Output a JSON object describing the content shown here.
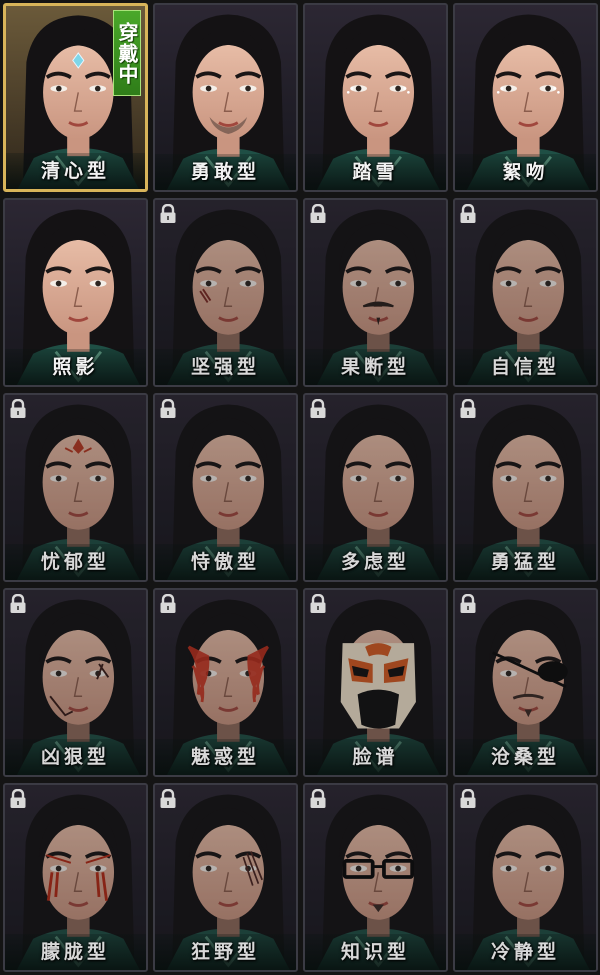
{
  "wearing_badge": "穿戴中",
  "colors": {
    "selected_border": "#d8b45a",
    "badge_green": "#3d9a24",
    "robe": "#1f4f45"
  },
  "faces": [
    {
      "label": "清心型",
      "locked": false,
      "selected": true,
      "markings": "forehead-jewel"
    },
    {
      "label": "勇敢型",
      "locked": false,
      "selected": false,
      "markings": "stubble"
    },
    {
      "label": "踏雪",
      "locked": false,
      "selected": false,
      "markings": "white-eye-dots"
    },
    {
      "label": "絮吻",
      "locked": false,
      "selected": false,
      "markings": "white-eye-dots"
    },
    {
      "label": "照影",
      "locked": false,
      "selected": false,
      "markings": "none"
    },
    {
      "label": "坚强型",
      "locked": true,
      "selected": false,
      "markings": "cheek-scar"
    },
    {
      "label": "果断型",
      "locked": true,
      "selected": false,
      "markings": "mustache"
    },
    {
      "label": "自信型",
      "locked": true,
      "selected": false,
      "markings": "none"
    },
    {
      "label": "忧郁型",
      "locked": true,
      "selected": false,
      "markings": "red-forehead-mark"
    },
    {
      "label": "恃傲型",
      "locked": true,
      "selected": false,
      "markings": "none"
    },
    {
      "label": "多虑型",
      "locked": true,
      "selected": false,
      "markings": "none"
    },
    {
      "label": "勇猛型",
      "locked": true,
      "selected": false,
      "markings": "none"
    },
    {
      "label": "凶狠型",
      "locked": true,
      "selected": false,
      "markings": "face-scars"
    },
    {
      "label": "魅惑型",
      "locked": true,
      "selected": false,
      "markings": "red-flame-paint"
    },
    {
      "label": "脸谱",
      "locked": true,
      "selected": false,
      "markings": "opera-mask"
    },
    {
      "label": "沧桑型",
      "locked": true,
      "selected": false,
      "markings": "eyepatch"
    },
    {
      "label": "朦胧型",
      "locked": true,
      "selected": false,
      "markings": "red-tear-stripes"
    },
    {
      "label": "狂野型",
      "locked": true,
      "selected": false,
      "markings": "eye-scar"
    },
    {
      "label": "知识型",
      "locked": true,
      "selected": false,
      "markings": "glasses"
    },
    {
      "label": "冷静型",
      "locked": true,
      "selected": false,
      "markings": "none"
    }
  ]
}
